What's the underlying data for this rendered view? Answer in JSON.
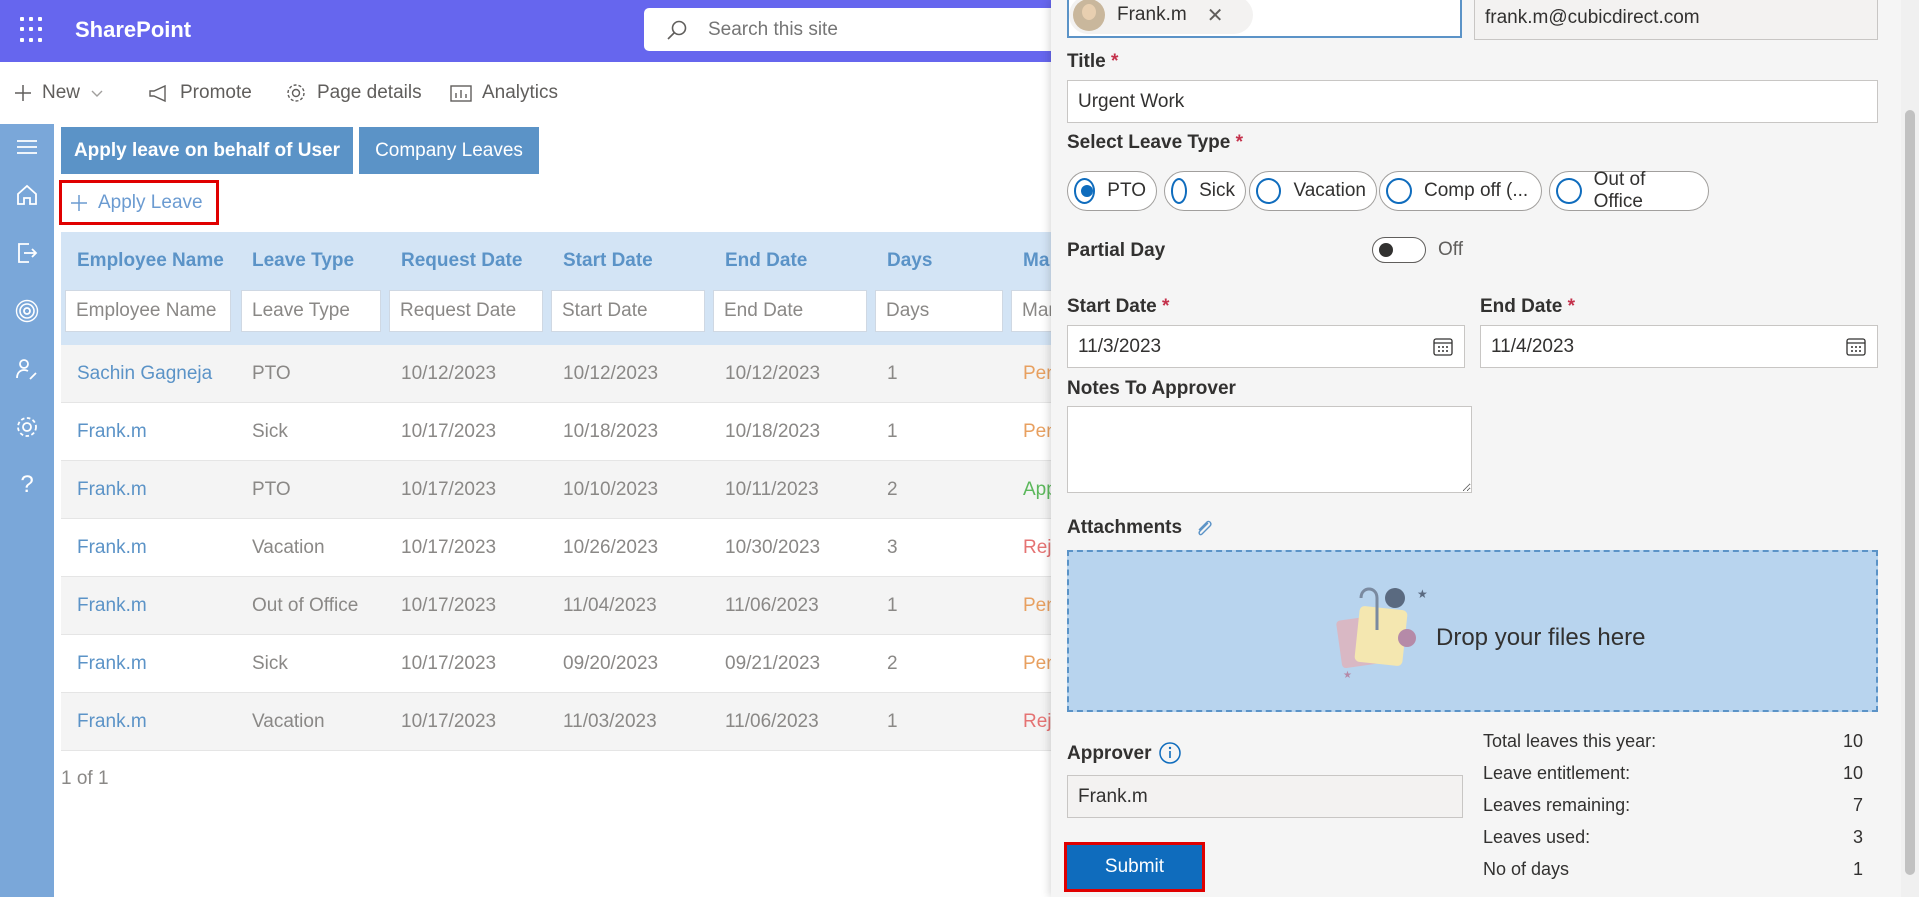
{
  "suite": {
    "brand": "SharePoint",
    "search_placeholder": "Search this site"
  },
  "commands": {
    "new": "New",
    "promote": "Promote",
    "page_details": "Page details",
    "analytics": "Analytics"
  },
  "tabs": {
    "tab1": "Apply leave on behalf of User",
    "tab2": "Company Leaves"
  },
  "apply_leave": "Apply Leave",
  "grid": {
    "columns": [
      "Employee Name",
      "Leave Type",
      "Request Date",
      "Start Date",
      "End Date",
      "Days",
      "Ma"
    ],
    "filters": [
      "Employee Name",
      "Leave Type",
      "Request Date",
      "Start Date",
      "End Date",
      "Days",
      "Man"
    ],
    "rows": [
      {
        "name": "Sachin Gagneja",
        "type": "PTO",
        "req": "10/12/2023",
        "start": "10/12/2023",
        "end": "10/12/2023",
        "days": "1",
        "status": "Pen",
        "status_color": "#e8a060"
      },
      {
        "name": "Frank.m",
        "type": "Sick",
        "req": "10/17/2023",
        "start": "10/18/2023",
        "end": "10/18/2023",
        "days": "1",
        "status": "Pen",
        "status_color": "#e8a060"
      },
      {
        "name": "Frank.m",
        "type": "PTO",
        "req": "10/17/2023",
        "start": "10/10/2023",
        "end": "10/11/2023",
        "days": "2",
        "status": "App",
        "status_color": "#5cb85c"
      },
      {
        "name": "Frank.m",
        "type": "Vacation",
        "req": "10/17/2023",
        "start": "10/26/2023",
        "end": "10/30/2023",
        "days": "3",
        "status": "Reje",
        "status_color": "#e57373"
      },
      {
        "name": "Frank.m",
        "type": "Out of Office",
        "req": "10/17/2023",
        "start": "11/04/2023",
        "end": "11/06/2023",
        "days": "1",
        "status": "Pen",
        "status_color": "#e8a060"
      },
      {
        "name": "Frank.m",
        "type": "Sick",
        "req": "10/17/2023",
        "start": "09/20/2023",
        "end": "09/21/2023",
        "days": "2",
        "status": "Pen",
        "status_color": "#e8a060"
      },
      {
        "name": "Frank.m",
        "type": "Vacation",
        "req": "10/17/2023",
        "start": "11/03/2023",
        "end": "11/06/2023",
        "days": "1",
        "status": "Reje",
        "status_color": "#e57373"
      }
    ],
    "pager": "1 of 1"
  },
  "form": {
    "person_chip": "Frank.m",
    "email": "frank.m@cubicdirect.com",
    "title_label": "Title",
    "title_value": "Urgent Work",
    "leave_type_label": "Select Leave Type",
    "leave_types": [
      "PTO",
      "Sick",
      "Vacation",
      "Comp off (...",
      "Out of Office"
    ],
    "selected_leave_type": "PTO",
    "partial_day_label": "Partial Day",
    "partial_day_state": "Off",
    "start_label": "Start Date",
    "start_value": "11/3/2023",
    "end_label": "End Date",
    "end_value": "11/4/2023",
    "notes_label": "Notes To Approver",
    "notes_value": "",
    "attachments_label": "Attachments",
    "drop_text": "Drop your files here",
    "approver_label": "Approver",
    "approver_value": "Frank.m",
    "submit": "Submit",
    "required_mark": "*"
  },
  "stats": [
    {
      "label": "Total leaves this year:",
      "value": "10"
    },
    {
      "label": "Leave entitlement:",
      "value": "10"
    },
    {
      "label": "Leaves remaining:",
      "value": "7"
    },
    {
      "label": "Leaves used:",
      "value": "3"
    },
    {
      "label": "No of days",
      "value": "1"
    }
  ],
  "colors": {
    "suitebar": "#6666ee",
    "accent": "#5b93c7",
    "primary": "#0f6cbd",
    "highlight_border": "#e00000"
  }
}
